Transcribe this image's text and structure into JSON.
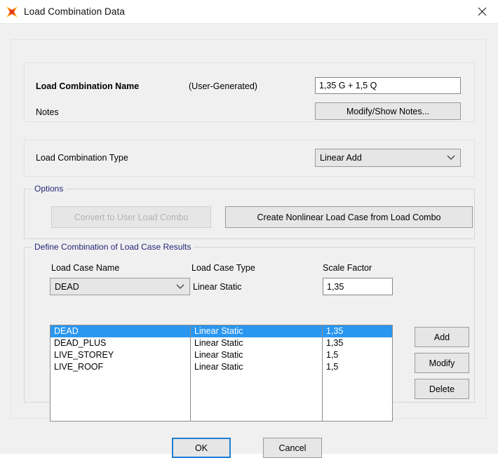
{
  "window": {
    "title": "Load Combination Data",
    "icon": "csi-star-icon",
    "close_label": "✕",
    "accent_blue": "#1f7fd4",
    "selection_blue": "#2a96f0",
    "legend_color": "#26267a"
  },
  "name_section": {
    "label": "Load Combination Name",
    "generated_note": "(User-Generated)",
    "name_value": "1,35 G + 1,5 Q",
    "notes_label": "Notes",
    "notes_button": "Modify/Show Notes..."
  },
  "type_section": {
    "label": "Load Combination Type",
    "selected": "Linear Add",
    "options": [
      "Linear Add"
    ],
    "chevron_icon": "chevron-down-icon"
  },
  "options_group": {
    "legend": "Options",
    "convert_button": "Convert to User Load Combo",
    "convert_button_disabled": true,
    "create_nonlinear_button": "Create Nonlinear Load Case from Load Combo"
  },
  "define_group": {
    "legend": "Define Combination of Load Case Results",
    "columns": [
      "Load Case Name",
      "Load Case Type",
      "Scale Factor"
    ],
    "editor": {
      "load_case_name": "DEAD",
      "load_case_name_options": [
        "DEAD",
        "DEAD_PLUS",
        "LIVE_STOREY",
        "LIVE_ROOF"
      ],
      "load_case_type": "Linear Static",
      "scale_factor": "1,35",
      "chevron_icon": "chevron-down-icon"
    },
    "rows": [
      {
        "name": "DEAD",
        "type": "Linear Static",
        "scale": "1,35",
        "selected": true
      },
      {
        "name": "DEAD_PLUS",
        "type": "Linear Static",
        "scale": "1,35",
        "selected": false
      },
      {
        "name": "LIVE_STOREY",
        "type": "Linear Static",
        "scale": "1,5",
        "selected": false
      },
      {
        "name": "LIVE_ROOF",
        "type": "Linear Static",
        "scale": "1,5",
        "selected": false
      }
    ],
    "side_buttons": [
      "Add",
      "Modify",
      "Delete"
    ]
  },
  "footer": {
    "ok": "OK",
    "cancel": "Cancel"
  }
}
